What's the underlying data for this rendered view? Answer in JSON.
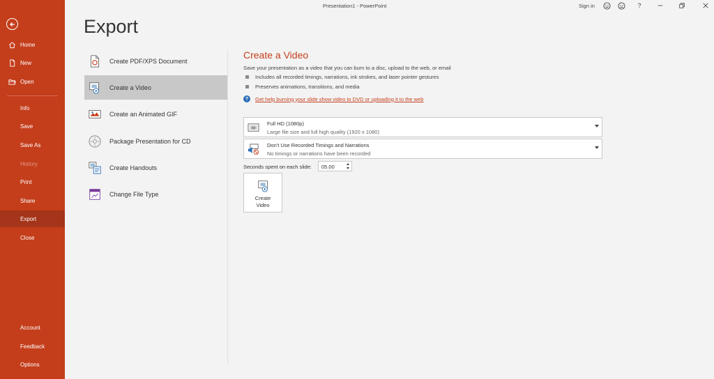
{
  "window": {
    "title": "Presentation1 - PowerPoint",
    "sign_in": "Sign in",
    "help": "?"
  },
  "sidebar": {
    "items": [
      {
        "label": "Home",
        "icon": "home-icon"
      },
      {
        "label": "New",
        "icon": "new-file-icon"
      },
      {
        "label": "Open",
        "icon": "open-folder-icon"
      },
      {
        "label": "Info"
      },
      {
        "label": "Save"
      },
      {
        "label": "Save As"
      },
      {
        "label": "History"
      },
      {
        "label": "Print"
      },
      {
        "label": "Share"
      },
      {
        "label": "Export"
      },
      {
        "label": "Close"
      },
      {
        "label": "Account"
      },
      {
        "label": "Feedback"
      },
      {
        "label": "Options"
      }
    ],
    "active": "Export",
    "disabled": "History"
  },
  "page": {
    "title": "Export"
  },
  "export_options": [
    {
      "label": "Create PDF/XPS Document",
      "icon": "pdf-document-icon"
    },
    {
      "label": "Create a Video",
      "icon": "video-icon"
    },
    {
      "label": "Create an Animated GIF",
      "icon": "animated-gif-icon"
    },
    {
      "label": "Package Presentation for CD",
      "icon": "cd-icon"
    },
    {
      "label": "Create Handouts",
      "icon": "handouts-icon"
    },
    {
      "label": "Change File Type",
      "icon": "change-file-type-icon"
    }
  ],
  "selected_option": "Create a Video",
  "detail": {
    "title": "Create a Video",
    "description": "Save your presentation as a video that you can burn to a disc, upload to the web, or email",
    "bullets": [
      "Includes all recorded timings, narrations, ink strokes, and laser pointer gestures",
      "Preserves animations, transitions, and media"
    ],
    "help_link": "Get help burning your slide show video to DVD or uploading it to the web",
    "quality_dropdown": {
      "main": "Full HD (1080p)",
      "sub": "Large file size and full high quality (1920 x 1080)"
    },
    "timings_dropdown": {
      "main": "Don't Use Recorded Timings and Narrations",
      "sub": "No timings or narrations have been recorded"
    },
    "seconds_label": "Seconds spent on each slide:",
    "seconds_value": "05.00",
    "create_button": "Create\nVideo"
  },
  "colors": {
    "accent": "#c43e1c",
    "sidebar_active": "#a4341a",
    "selection": "#c8c8c8",
    "background": "#f3f3f3"
  }
}
